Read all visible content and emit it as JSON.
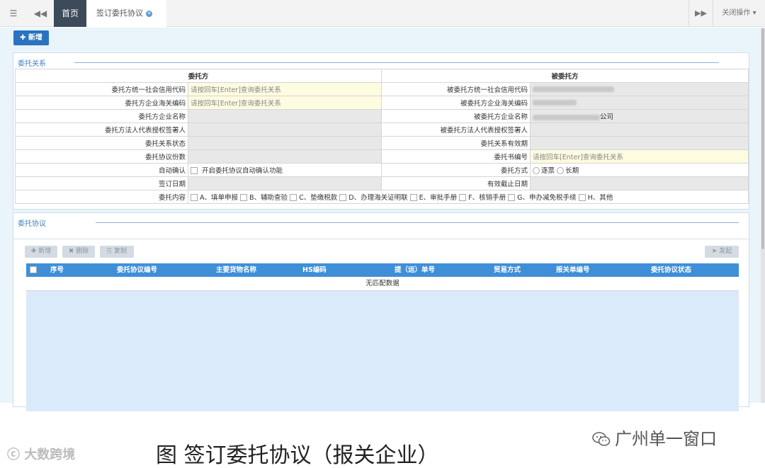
{
  "tabbar": {
    "home": "首页",
    "active_tab": "签订委托协议",
    "close_ops": "关闭操作"
  },
  "toolbar": {
    "new_label": "新增"
  },
  "relation": {
    "legend": "委托关系",
    "left_header": "委托方",
    "right_header": "被委托方",
    "rows": [
      {
        "l_label": "委托方统一社会信用代码",
        "l_value": "请按回车[Enter]查询委托关系",
        "r_label": "被委托方统一社会信用代码"
      },
      {
        "l_label": "委托方企业海关编码",
        "l_value": "请按回车[Enter]查询委托关系",
        "r_label": "被委托方企业海关编码"
      },
      {
        "l_label": "委托方企业名称",
        "r_label": "被委托方企业名称",
        "r_suffix": "公司"
      },
      {
        "l_label": "委托方法人代表授权签署人",
        "r_label": "被委托方法人代表授权签署人"
      },
      {
        "l_label": "委托关系状态",
        "r_label": "委托关系有效期"
      },
      {
        "l_label": "委托协议份数",
        "r_label": "委托书编号",
        "r_value": "请按回车[Enter]查询委托关系"
      },
      {
        "l_label": "自动确认",
        "l_check": "开启委托协议自动确认功能",
        "r_label": "委托方式",
        "r_opt1": "逐票",
        "r_opt2": "长期"
      },
      {
        "l_label": "签订日期",
        "r_label": "有效截止日期"
      }
    ],
    "content_label": "委托内容",
    "content_options": [
      "A、填单申报",
      "B、辅助查验",
      "C、垫缴税款",
      "D、办理海关证明联",
      "E、审批手册",
      "F、核销手册",
      "G、申办减免税手续",
      "H、其他"
    ]
  },
  "agreement": {
    "legend": "委托协议",
    "btn_new": "新增",
    "btn_delete": "删除",
    "btn_copy": "复制",
    "btn_send": "发起",
    "columns": [
      "序号",
      "委托协议编号",
      "主要货物名称",
      "HS编码",
      "提（运）单号",
      "贸易方式",
      "报关单编号",
      "委托协议状态"
    ],
    "empty_text": "无匹配数据"
  },
  "caption": "图  签订委托协议（报关企业）",
  "watermark_left": "大数跨境",
  "watermark_right": "广州单一窗口",
  "colors": {
    "primary": "#2a73c0",
    "grid_header": "#3f8fd8",
    "home_tab": "#3c4a5a"
  }
}
